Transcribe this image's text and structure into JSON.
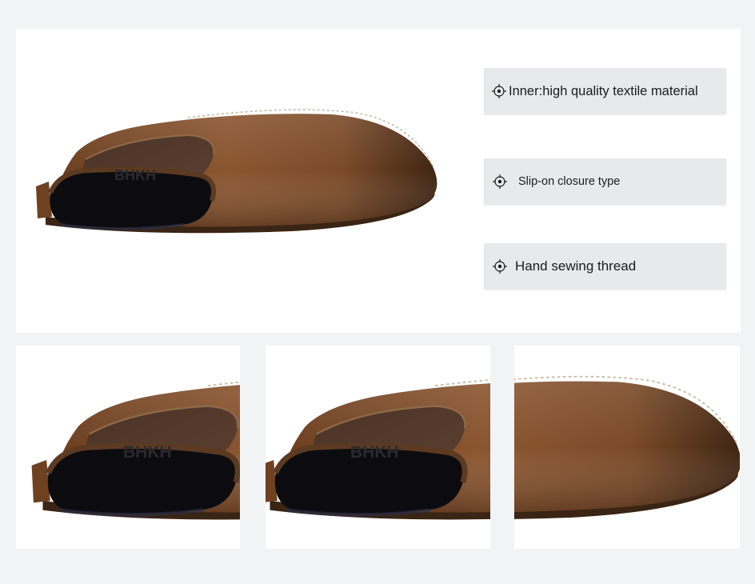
{
  "product": {
    "brand_text": "BHKH",
    "features": [
      {
        "icon": "crosshair-icon",
        "label": "Inner:high quality textile material"
      },
      {
        "icon": "crosshair-icon",
        "label": "Slip-on closure type"
      },
      {
        "icon": "crosshair-icon",
        "label": "Hand sewing thread"
      }
    ]
  },
  "colors": {
    "page_background": "#f1f3f5",
    "panel_background": "#ffffff",
    "feature_background": "#e8e9eb",
    "leather": "#7a4a26",
    "lining": "#0c0c10"
  }
}
